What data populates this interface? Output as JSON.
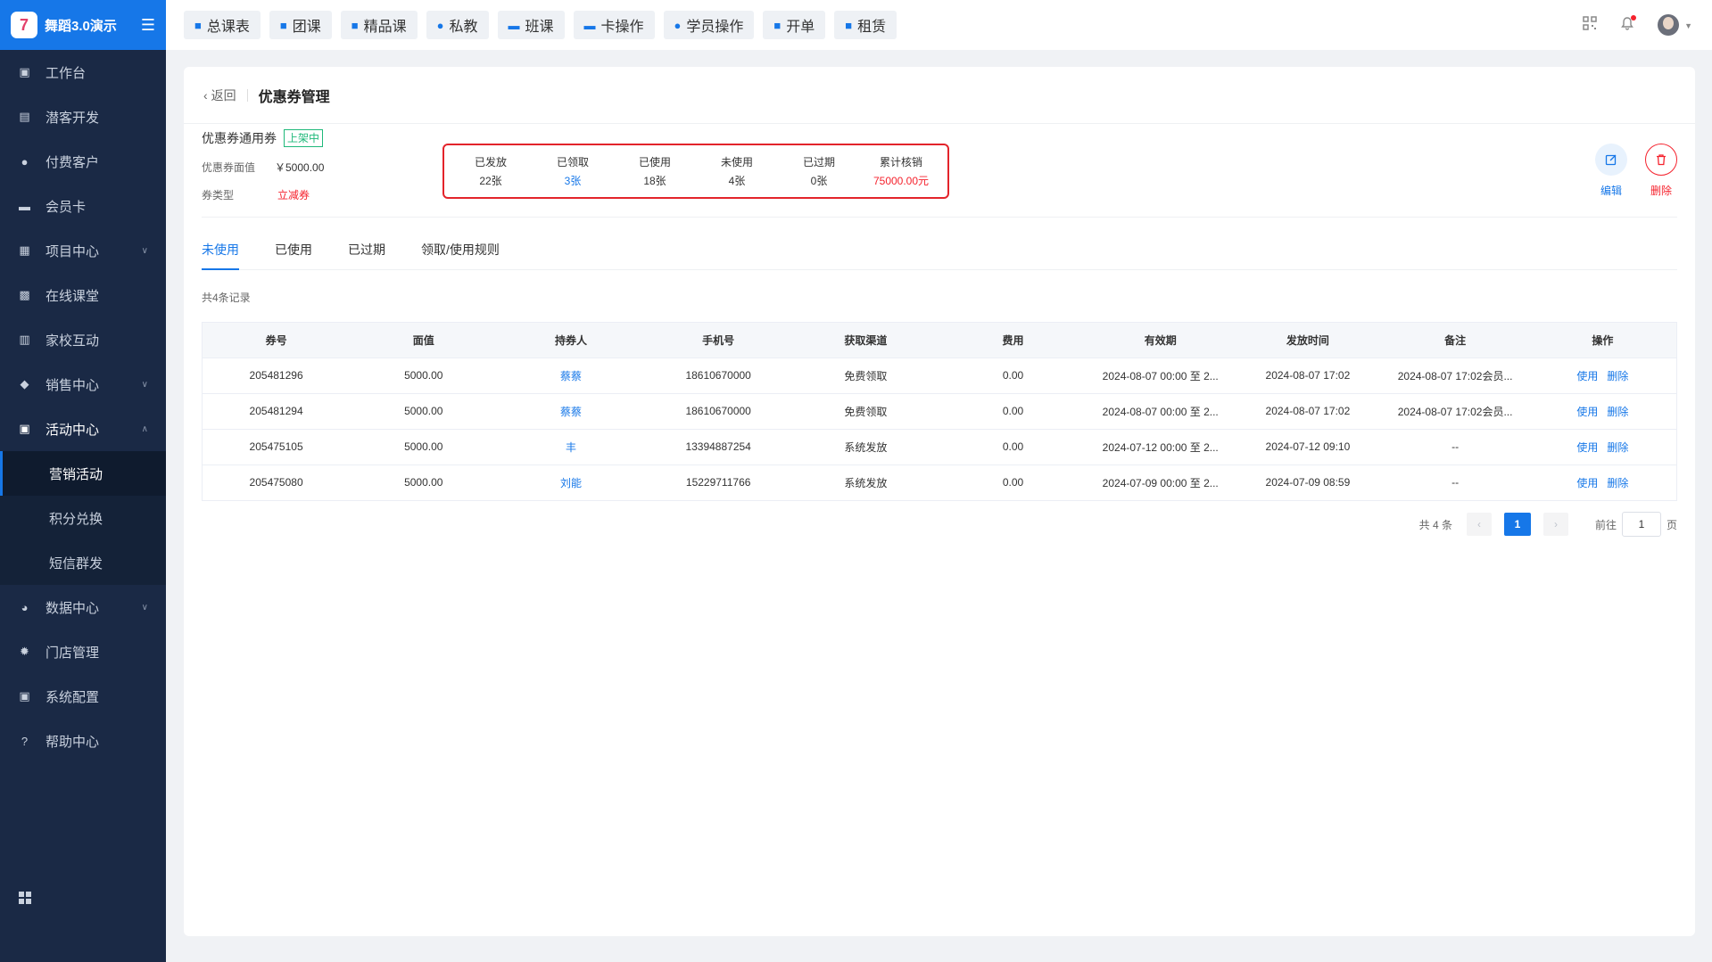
{
  "brand": {
    "name": "舞蹈3.0演示",
    "logo_text": "7"
  },
  "sidebar": {
    "items": [
      {
        "label": "工作台",
        "icon": "monitor-icon"
      },
      {
        "label": "潜客开发",
        "icon": "id-card-icon"
      },
      {
        "label": "付费客户",
        "icon": "users-icon"
      },
      {
        "label": "会员卡",
        "icon": "card-icon"
      },
      {
        "label": "项目中心",
        "icon": "folder-icon",
        "chevron": "down"
      },
      {
        "label": "在线课堂",
        "icon": "tv-icon"
      },
      {
        "label": "家校互动",
        "icon": "book-icon"
      },
      {
        "label": "销售中心",
        "icon": "tag-icon",
        "chevron": "down"
      },
      {
        "label": "活动中心",
        "icon": "calendar-icon",
        "chevron": "up"
      }
    ],
    "sub_items": [
      {
        "label": "营销活动",
        "active": true
      },
      {
        "label": "积分兑换",
        "active": false
      },
      {
        "label": "短信群发",
        "active": false
      }
    ],
    "items_after": [
      {
        "label": "数据中心",
        "icon": "pie-chart-icon",
        "chevron": "down"
      },
      {
        "label": "门店管理",
        "icon": "gear-icon"
      },
      {
        "label": "系统配置",
        "icon": "screen-icon"
      },
      {
        "label": "帮助中心",
        "icon": "help-icon"
      }
    ]
  },
  "topbar": {
    "tabs": [
      "总课表",
      "团课",
      "精品课",
      "私教",
      "班课",
      "卡操作",
      "学员操作",
      "开单",
      "租赁"
    ]
  },
  "page": {
    "back_label": "返回",
    "title": "优惠券管理",
    "coupon": {
      "name": "优惠券通用券",
      "status": "上架中",
      "face_value_label": "优惠券面值",
      "face_value": "￥5000.00",
      "type_label": "券类型",
      "type": "立减券"
    },
    "stats": [
      {
        "label": "已发放",
        "value": "22张",
        "color": "#333333"
      },
      {
        "label": "已领取",
        "value": "3张",
        "color": "#1677e8"
      },
      {
        "label": "已使用",
        "value": "18张",
        "color": "#333333"
      },
      {
        "label": "未使用",
        "value": "4张",
        "color": "#333333"
      },
      {
        "label": "已过期",
        "value": "0张",
        "color": "#333333"
      },
      {
        "label": "累计核销",
        "value": "75000.00元",
        "color": "#f5222d"
      }
    ],
    "actions": {
      "edit": "编辑",
      "delete": "删除"
    },
    "tabs": [
      "未使用",
      "已使用",
      "已过期",
      "领取/使用规则"
    ],
    "active_tab": 0,
    "records_text": "共4条记录",
    "table": {
      "columns": [
        "券号",
        "面值",
        "持券人",
        "手机号",
        "获取渠道",
        "费用",
        "有效期",
        "发放时间",
        "备注",
        "操作"
      ],
      "rows": [
        {
          "no": "205481296",
          "value": "5000.00",
          "holder": "蔡蔡",
          "phone": "18610670000",
          "channel": "免费领取",
          "fee": "0.00",
          "validity": "2024-08-07 00:00 至 2...",
          "issued": "2024-08-07 17:02",
          "note": "2024-08-07 17:02会员..."
        },
        {
          "no": "205481294",
          "value": "5000.00",
          "holder": "蔡蔡",
          "phone": "18610670000",
          "channel": "免费领取",
          "fee": "0.00",
          "validity": "2024-08-07 00:00 至 2...",
          "issued": "2024-08-07 17:02",
          "note": "2024-08-07 17:02会员..."
        },
        {
          "no": "205475105",
          "value": "5000.00",
          "holder": "丰",
          "phone": "13394887254",
          "channel": "系统发放",
          "fee": "0.00",
          "validity": "2024-07-12 00:00 至 2...",
          "issued": "2024-07-12 09:10",
          "note": "--"
        },
        {
          "no": "205475080",
          "value": "5000.00",
          "holder": "刘能",
          "phone": "15229711766",
          "channel": "系统发放",
          "fee": "0.00",
          "validity": "2024-07-09 00:00 至 2...",
          "issued": "2024-07-09 08:59",
          "note": "--"
        }
      ],
      "row_actions": [
        "使用",
        "删除"
      ]
    },
    "pagination": {
      "total_text": "共 4 条",
      "current_page": "1",
      "goto_label": "前往",
      "goto_value": "1",
      "page_unit": "页"
    }
  },
  "colors": {
    "accent": "#1677e8",
    "danger": "#f5222d",
    "success": "#1fb97a",
    "sidebar": "#1a2945"
  }
}
